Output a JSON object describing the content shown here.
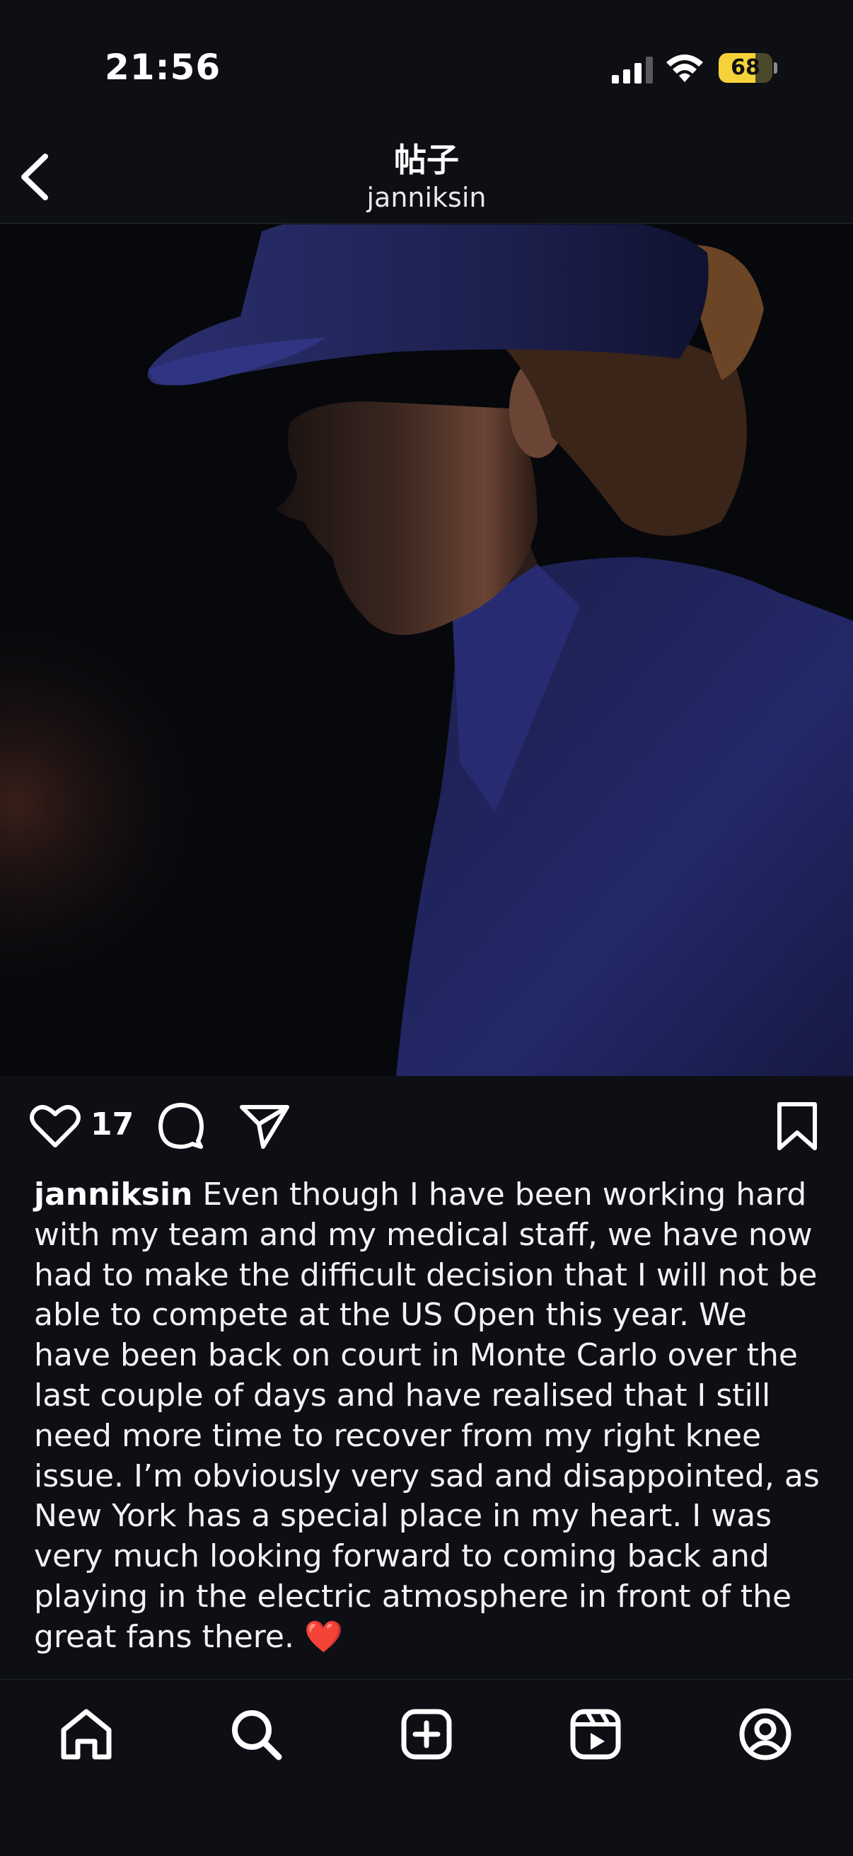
{
  "status_bar": {
    "time": "21:56",
    "battery_level": "68",
    "battery_fraction": 0.68,
    "signal_bars": 3,
    "icons": [
      "cellular-signal-icon",
      "wifi-icon",
      "battery-icon"
    ],
    "battery_color": "#f5d23a"
  },
  "header": {
    "title": "帖子",
    "username": "janniksin",
    "back_icon": "chevron-left-icon"
  },
  "post": {
    "image_description_icon": "photo",
    "like_count": "17",
    "action_icons": [
      "heart-icon",
      "comment-icon",
      "share-icon",
      "bookmark-icon"
    ],
    "caption_username": "janniksin",
    "caption_text": " Even though I have been working hard with my team and my medical staff, we have now had to make the difficult decision that I will not be able to compete at the US Open this year. We have been back on court in Monte Carlo over the last couple of days and have realised that I still need more time to recover from my right knee issue. I’m obviously very sad and disappointed, as New York has a special place in my heart. I was very much looking forward to coming back and playing in the electric atmosphere in front of the great fans there. ",
    "caption_emoji": "❤️"
  },
  "bottom_nav": {
    "items": [
      "home-icon",
      "search-icon",
      "create-post-icon",
      "reels-icon",
      "profile-icon"
    ]
  },
  "colors": {
    "background": "#0d0f14",
    "text": "#f2f2f2",
    "heart_emoji": "#e8252f"
  }
}
